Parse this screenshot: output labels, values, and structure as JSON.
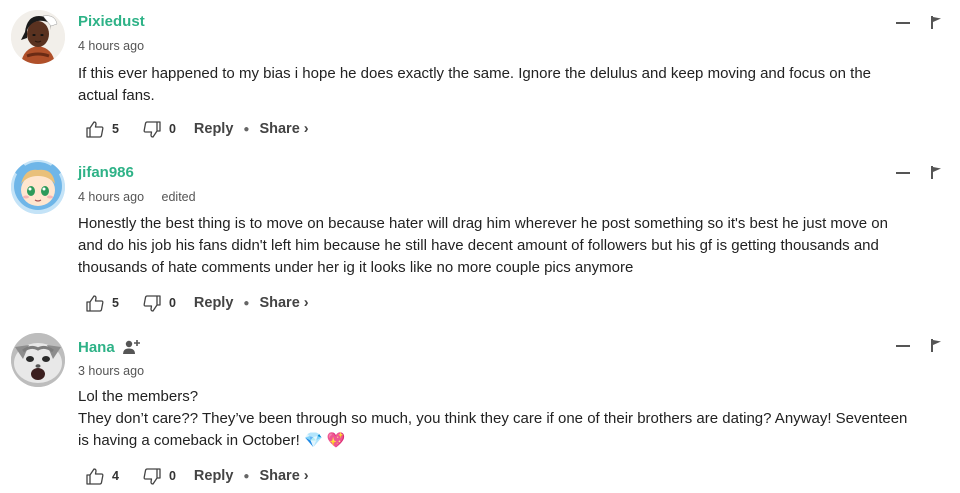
{
  "comments": [
    {
      "username": "Pixiedust",
      "time": "4 hours ago",
      "edited": "",
      "lines": [
        "If this ever happened to my bias i hope he does exactly the same. Ignore the delulus and keep moving and focus on the",
        "actual fans."
      ],
      "likes": "5",
      "dislikes": "0",
      "reply": "Reply",
      "share": "Share ›"
    },
    {
      "username": "jifan986",
      "time": "4 hours ago",
      "edited": "edited",
      "lines": [
        "Honestly the best thing is to move on because hater will drag him wherever he post something so it's best he just move on",
        "and do his job his fans didn't left him because he still have decent amount of followers but his gf is getting thousands and",
        "thousands of hate comments under her ig it looks like no more couple pics anymore"
      ],
      "likes": "5",
      "dislikes": "0",
      "reply": "Reply",
      "share": "Share ›"
    },
    {
      "username": "Hana",
      "time": "3 hours ago",
      "edited": "",
      "lines": [
        "Lol the members?",
        "They don’t care?? They’ve been through so much, you think they care if one of their brothers are dating? Anyway! Seventeen",
        "is having a comeback in October! 💎 💖"
      ],
      "likes": "4",
      "dislikes": "0",
      "reply": "Reply",
      "share": "Share ›"
    }
  ],
  "colors": {
    "username": "#2eb287",
    "text": "#222222",
    "meta": "#555555"
  },
  "icons": [
    "thumb-up-icon",
    "thumb-down-icon",
    "collapse-icon",
    "flag-icon",
    "add-user-icon"
  ]
}
